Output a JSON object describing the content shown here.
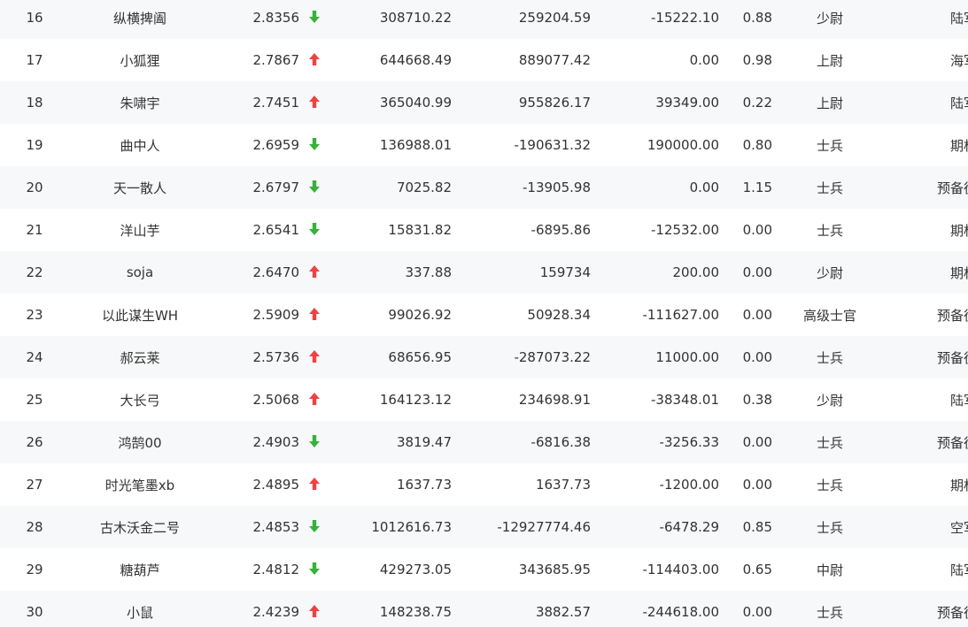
{
  "colors": {
    "up": "#f04142",
    "down": "#36b23a",
    "row_alt": "#f7f8fa"
  },
  "rows": [
    {
      "rank": "16",
      "name": "纵横捭阖",
      "score": "2.8356",
      "trend": "down",
      "v1": "308710.22",
      "v2": "259204.59",
      "v3": "-15222.10",
      "ratio": "0.88",
      "level": "少尉",
      "category": "陆军"
    },
    {
      "rank": "17",
      "name": "小狐狸",
      "score": "2.7867",
      "trend": "up",
      "v1": "644668.49",
      "v2": "889077.42",
      "v3": "0.00",
      "ratio": "0.98",
      "level": "上尉",
      "category": "海军"
    },
    {
      "rank": "18",
      "name": "朱啸宇",
      "score": "2.7451",
      "trend": "up",
      "v1": "365040.99",
      "v2": "955826.17",
      "v3": "39349.00",
      "ratio": "0.22",
      "level": "上尉",
      "category": "陆军"
    },
    {
      "rank": "19",
      "name": "曲中人",
      "score": "2.6959",
      "trend": "down",
      "v1": "136988.01",
      "v2": "-190631.32",
      "v3": "190000.00",
      "ratio": "0.80",
      "level": "士兵",
      "category": "期权"
    },
    {
      "rank": "20",
      "name": "天一散人",
      "score": "2.6797",
      "trend": "down",
      "v1": "7025.82",
      "v2": "-13905.98",
      "v3": "0.00",
      "ratio": "1.15",
      "level": "士兵",
      "category": "预备役"
    },
    {
      "rank": "21",
      "name": "洋山芋",
      "score": "2.6541",
      "trend": "down",
      "v1": "15831.82",
      "v2": "-6895.86",
      "v3": "-12532.00",
      "ratio": "0.00",
      "level": "士兵",
      "category": "期权"
    },
    {
      "rank": "22",
      "name": "soja",
      "score": "2.6470",
      "trend": "up",
      "v1": "337.88",
      "v2": "159734",
      "v3": "200.00",
      "ratio": "0.00",
      "level": "少尉",
      "category": "期权"
    },
    {
      "rank": "23",
      "name": "以此谋生WH",
      "score": "2.5909",
      "trend": "up",
      "v1": "99026.92",
      "v2": "50928.34",
      "v3": "-111627.00",
      "ratio": "0.00",
      "level": "高级士官",
      "category": "预备役"
    },
    {
      "rank": "24",
      "name": "郝云莱",
      "score": "2.5736",
      "trend": "up",
      "v1": "68656.95",
      "v2": "-287073.22",
      "v3": "11000.00",
      "ratio": "0.00",
      "level": "士兵",
      "category": "预备役"
    },
    {
      "rank": "25",
      "name": "大长弓",
      "score": "2.5068",
      "trend": "up",
      "v1": "164123.12",
      "v2": "234698.91",
      "v3": "-38348.01",
      "ratio": "0.38",
      "level": "少尉",
      "category": "陆军"
    },
    {
      "rank": "26",
      "name": "鸿鹄00",
      "score": "2.4903",
      "trend": "down",
      "v1": "3819.47",
      "v2": "-6816.38",
      "v3": "-3256.33",
      "ratio": "0.00",
      "level": "士兵",
      "category": "预备役"
    },
    {
      "rank": "27",
      "name": "时光笔墨xb",
      "score": "2.4895",
      "trend": "up",
      "v1": "1637.73",
      "v2": "1637.73",
      "v3": "-1200.00",
      "ratio": "0.00",
      "level": "士兵",
      "category": "期权"
    },
    {
      "rank": "28",
      "name": "古木沃金二号",
      "score": "2.4853",
      "trend": "down",
      "v1": "1012616.73",
      "v2": "-12927774.46",
      "v3": "-6478.29",
      "ratio": "0.85",
      "level": "士兵",
      "category": "空军"
    },
    {
      "rank": "29",
      "name": "糖葫芦",
      "score": "2.4812",
      "trend": "down",
      "v1": "429273.05",
      "v2": "343685.95",
      "v3": "-114403.00",
      "ratio": "0.65",
      "level": "中尉",
      "category": "陆军"
    },
    {
      "rank": "30",
      "name": "小鼠",
      "score": "2.4239",
      "trend": "up",
      "v1": "148238.75",
      "v2": "3882.57",
      "v3": "-244618.00",
      "ratio": "0.00",
      "level": "士兵",
      "category": "预备役"
    }
  ]
}
